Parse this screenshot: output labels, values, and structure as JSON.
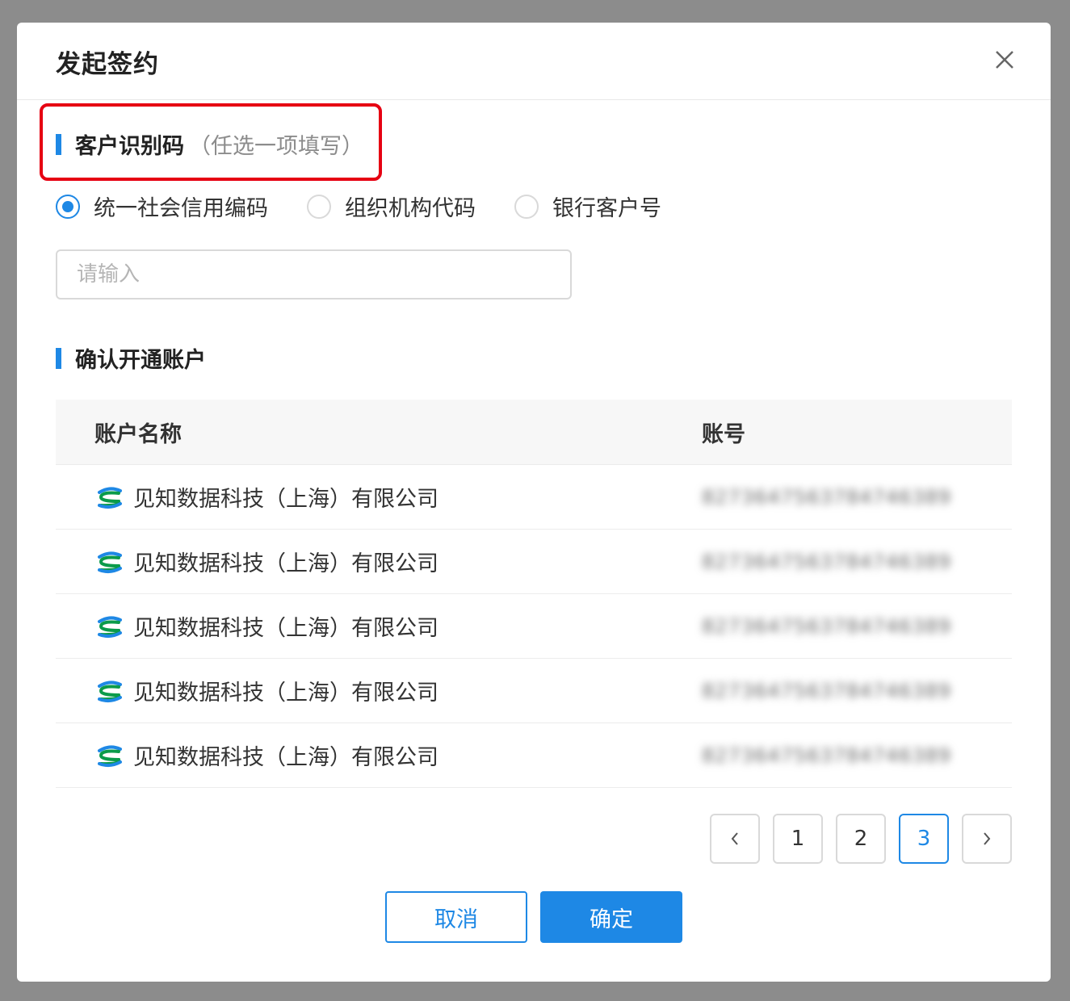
{
  "modal": {
    "title": "发起签约"
  },
  "identifier_section": {
    "title": "客户识别码",
    "hint": "（任选一项填写）",
    "options": [
      {
        "label": "统一社会信用编码",
        "checked": true
      },
      {
        "label": "组织机构代码",
        "checked": false
      },
      {
        "label": "银行客户号",
        "checked": false
      }
    ],
    "input_placeholder": "请输入",
    "input_value": ""
  },
  "account_section": {
    "title": "确认开通账户",
    "columns": {
      "name": "账户名称",
      "account": "账号"
    },
    "rows": [
      {
        "icon": "bank-logo-icon",
        "name": "见知数据科技（上海）有限公司",
        "account": "8273647563784746389"
      },
      {
        "icon": "bank-logo-icon",
        "name": "见知数据科技（上海）有限公司",
        "account": "8273647563784746389"
      },
      {
        "icon": "bank-logo-icon",
        "name": "见知数据科技（上海）有限公司",
        "account": "8273647563784746389"
      },
      {
        "icon": "bank-logo-icon",
        "name": "见知数据科技（上海）有限公司",
        "account": "8273647563784746389"
      },
      {
        "icon": "bank-logo-icon",
        "name": "见知数据科技（上海）有限公司",
        "account": "8273647563784746389"
      }
    ]
  },
  "pagination": {
    "pages": [
      "1",
      "2",
      "3"
    ],
    "current": "3"
  },
  "footer": {
    "cancel_label": "取消",
    "confirm_label": "确定"
  },
  "colors": {
    "accent": "#1e88e5",
    "highlight": "#e60012",
    "overlay": "#8c8c8c"
  }
}
